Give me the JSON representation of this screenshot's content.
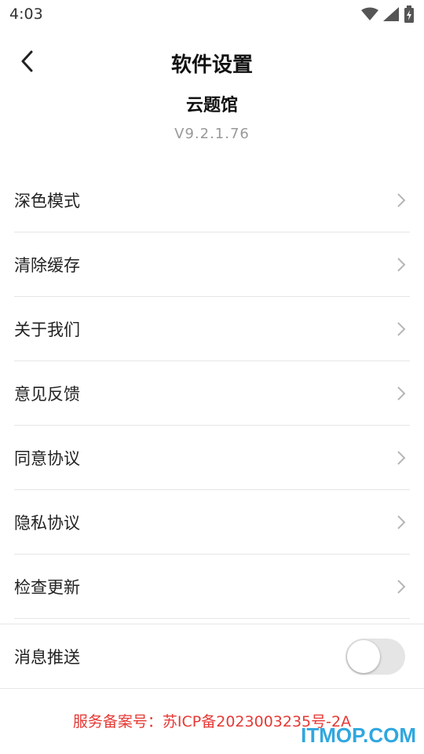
{
  "status_bar": {
    "time": "4:03",
    "icons": [
      "wifi-icon",
      "signal-icon",
      "battery-icon"
    ]
  },
  "header": {
    "title": "软件设置",
    "back_icon": "back-arrow-icon"
  },
  "app": {
    "name": "云题馆",
    "version": "V9.2.1.76"
  },
  "settings": {
    "items": [
      {
        "label": "深色模式"
      },
      {
        "label": "清除缓存"
      },
      {
        "label": "关于我们"
      },
      {
        "label": "意见反馈"
      },
      {
        "label": "同意协议"
      },
      {
        "label": "隐私协议"
      },
      {
        "label": "检查更新"
      }
    ],
    "push": {
      "label": "消息推送",
      "enabled": false
    }
  },
  "footer": {
    "icp": "服务备案号：苏ICP备2023003235号-2A"
  },
  "watermark": "ITMOP.COM",
  "colors": {
    "accent_red": "#e53935",
    "watermark_blue": "#2fa7e0",
    "toggle_off": "#e5e5e5"
  }
}
